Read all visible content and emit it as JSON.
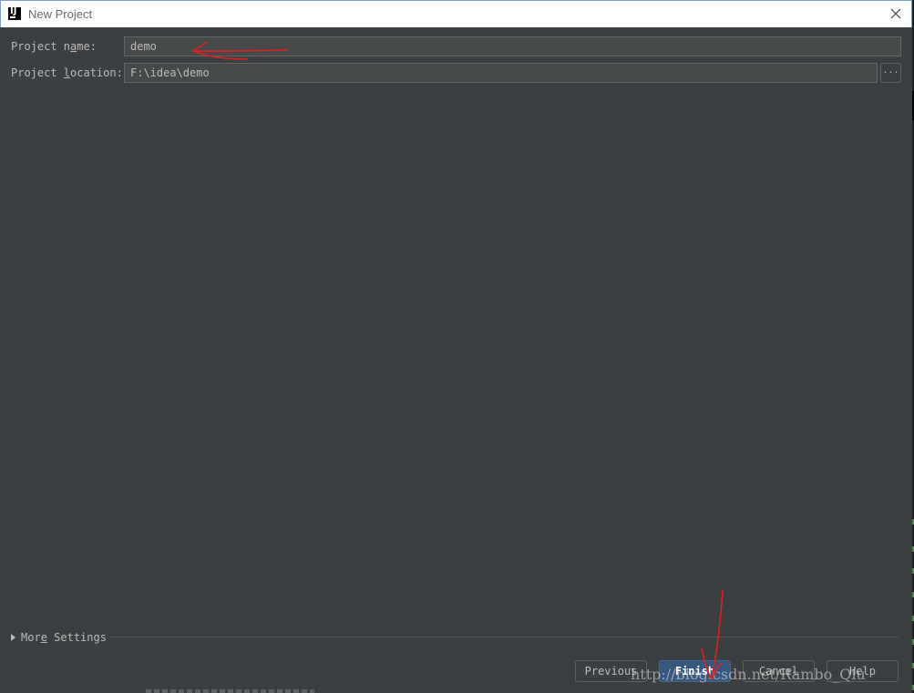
{
  "window": {
    "title": "New Project",
    "logo_icon": "intellij-idea-icon",
    "close_icon": "close-icon"
  },
  "form": {
    "project_name": {
      "label_pre": "Project n",
      "label_mnemonic": "a",
      "label_post": "me:",
      "value": "demo"
    },
    "project_location": {
      "label_pre": "Project ",
      "label_mnemonic": "l",
      "label_post": "ocation:",
      "value": "F:\\idea\\demo",
      "browse_label": "..."
    }
  },
  "more_settings": {
    "label_pre": "Mor",
    "label_mnemonic": "e",
    "label_post": " Settings"
  },
  "buttons": {
    "previous": "Previous",
    "finish": "Finish",
    "cancel": "Cancel",
    "help": "Help"
  },
  "watermark": "http://blog.csdn.net/Rambo_Qiu",
  "colors": {
    "background": "#3c3f41",
    "field": "#45494a",
    "primary_button": "#365880",
    "annotation": "#e02020"
  }
}
